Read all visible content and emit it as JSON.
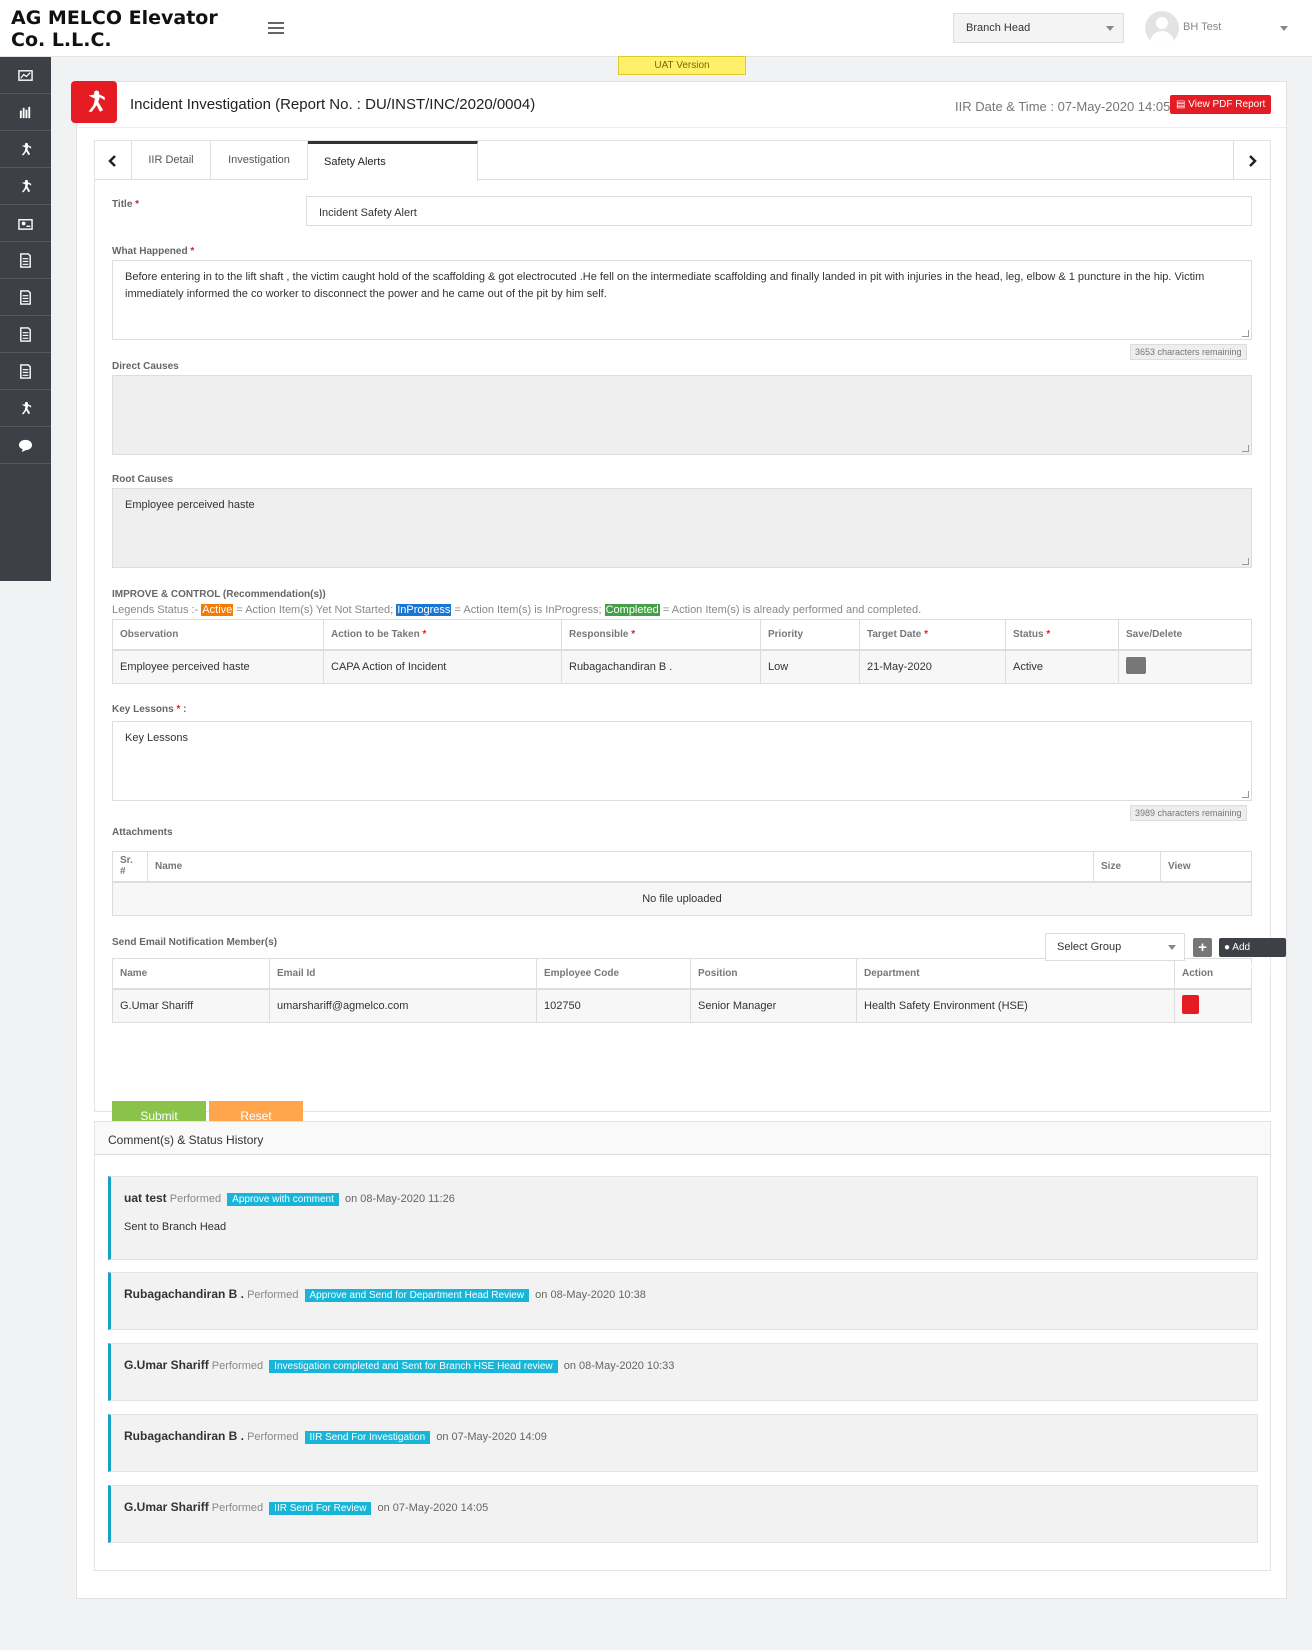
{
  "company": {
    "name": "AG MELCO Elevator Co. L.L.C."
  },
  "topbar": {
    "role": "Branch Head",
    "user_name": "BH Test"
  },
  "uat_label": "UAT Version",
  "header": {
    "title": "Incident Investigation (Report No. : DU/INST/INC/2020/0004)",
    "iir_date": "IIR Date & Time : 07-May-2020 14:05",
    "pdf_button": "View PDF Report"
  },
  "tabs": [
    "IIR Detail",
    "Investigation",
    "Safety Alerts"
  ],
  "form": {
    "title_label": "Title",
    "title_value": "Incident Safety Alert",
    "what_label": "What Happened",
    "what_value": "Before entering in to the lift shaft , the victim caught  hold of the  scaffolding  & got electrocuted .He fell  on the intermediate  scaffolding  and finally landed in pit with injuries in the head, leg, elbow & 1 puncture in the hip.  Victim immediately  informed  the co worker to disconnect the power  and he  came out of  the pit by him self.",
    "what_counter": "3653 characters remaining",
    "direct_label": "Direct Causes",
    "root_label": "Root Causes",
    "root_value": "Employee perceived haste",
    "improve_label": "IMPROVE & CONTROL (Recommendation(s))",
    "legend_prefix": "Legends Status :-",
    "legend_active": "Active",
    "legend_active_desc": "= Action Item(s) Yet Not Started;",
    "legend_inprogress": "InProgress",
    "legend_inprogress_desc": "= Action Item(s) is InProgress;",
    "legend_completed": "Completed",
    "legend_completed_desc": "= Action Item(s) is already performed and completed.",
    "key_label": "Key Lessons",
    "key_value": "Key Lessons",
    "key_counter": "3989 characters remaining",
    "attachments_label": "Attachments",
    "email_label": "Send Email Notification Member(s)",
    "select_group": "Select Group",
    "add_employees": "Add Employees",
    "submit": "Submit",
    "reset": "Reset"
  },
  "actions_table": {
    "headers": [
      "Observation",
      "Action to be Taken",
      "Responsible",
      "Priority",
      "Target Date",
      "Status",
      "Save/Delete"
    ],
    "rows": [
      [
        "Employee perceived haste",
        "CAPA Action of Incident",
        "Rubagachandiran B .",
        "Low",
        "21-May-2020",
        "Active"
      ]
    ]
  },
  "attachments_table": {
    "headers": [
      "Sr. #",
      "Name",
      "Size",
      "View"
    ],
    "empty": "No file uploaded"
  },
  "members_table": {
    "headers": [
      "Name",
      "Email Id",
      "Employee Code",
      "Position",
      "Department",
      "Action"
    ],
    "rows": [
      [
        "G.Umar Shariff",
        "umarshariff@agmelco.com",
        "102750",
        "Senior Manager",
        "Health Safety Environment (HSE)"
      ]
    ]
  },
  "comments": {
    "title": "Comment(s) & Status History",
    "performed": "Performed",
    "items": [
      {
        "who": "uat test",
        "action": "Approve with comment",
        "when": "on 08-May-2020 11:26",
        "msg": "Sent to Branch Head"
      },
      {
        "who": "Rubagachandiran B .",
        "action": "Approve and Send for Department Head Review",
        "when": "on 08-May-2020 10:38",
        "msg": ""
      },
      {
        "who": "G.Umar Shariff",
        "action": "Investigation completed and Sent for Branch HSE Head review",
        "when": "on 08-May-2020 10:33",
        "msg": ""
      },
      {
        "who": "Rubagachandiran B .",
        "action": "IIR Send For Investigation",
        "when": "on 07-May-2020 14:09",
        "msg": ""
      },
      {
        "who": "G.Umar Shariff",
        "action": "IIR Send For Review",
        "when": "on 07-May-2020 14:05",
        "msg": ""
      }
    ]
  },
  "colors": {
    "accent_red": "#e51c23",
    "active_orange": "#f57c00",
    "inprogress_blue": "#1976d2",
    "completed_green": "#43a047",
    "info_cyan": "#17b6d8"
  }
}
